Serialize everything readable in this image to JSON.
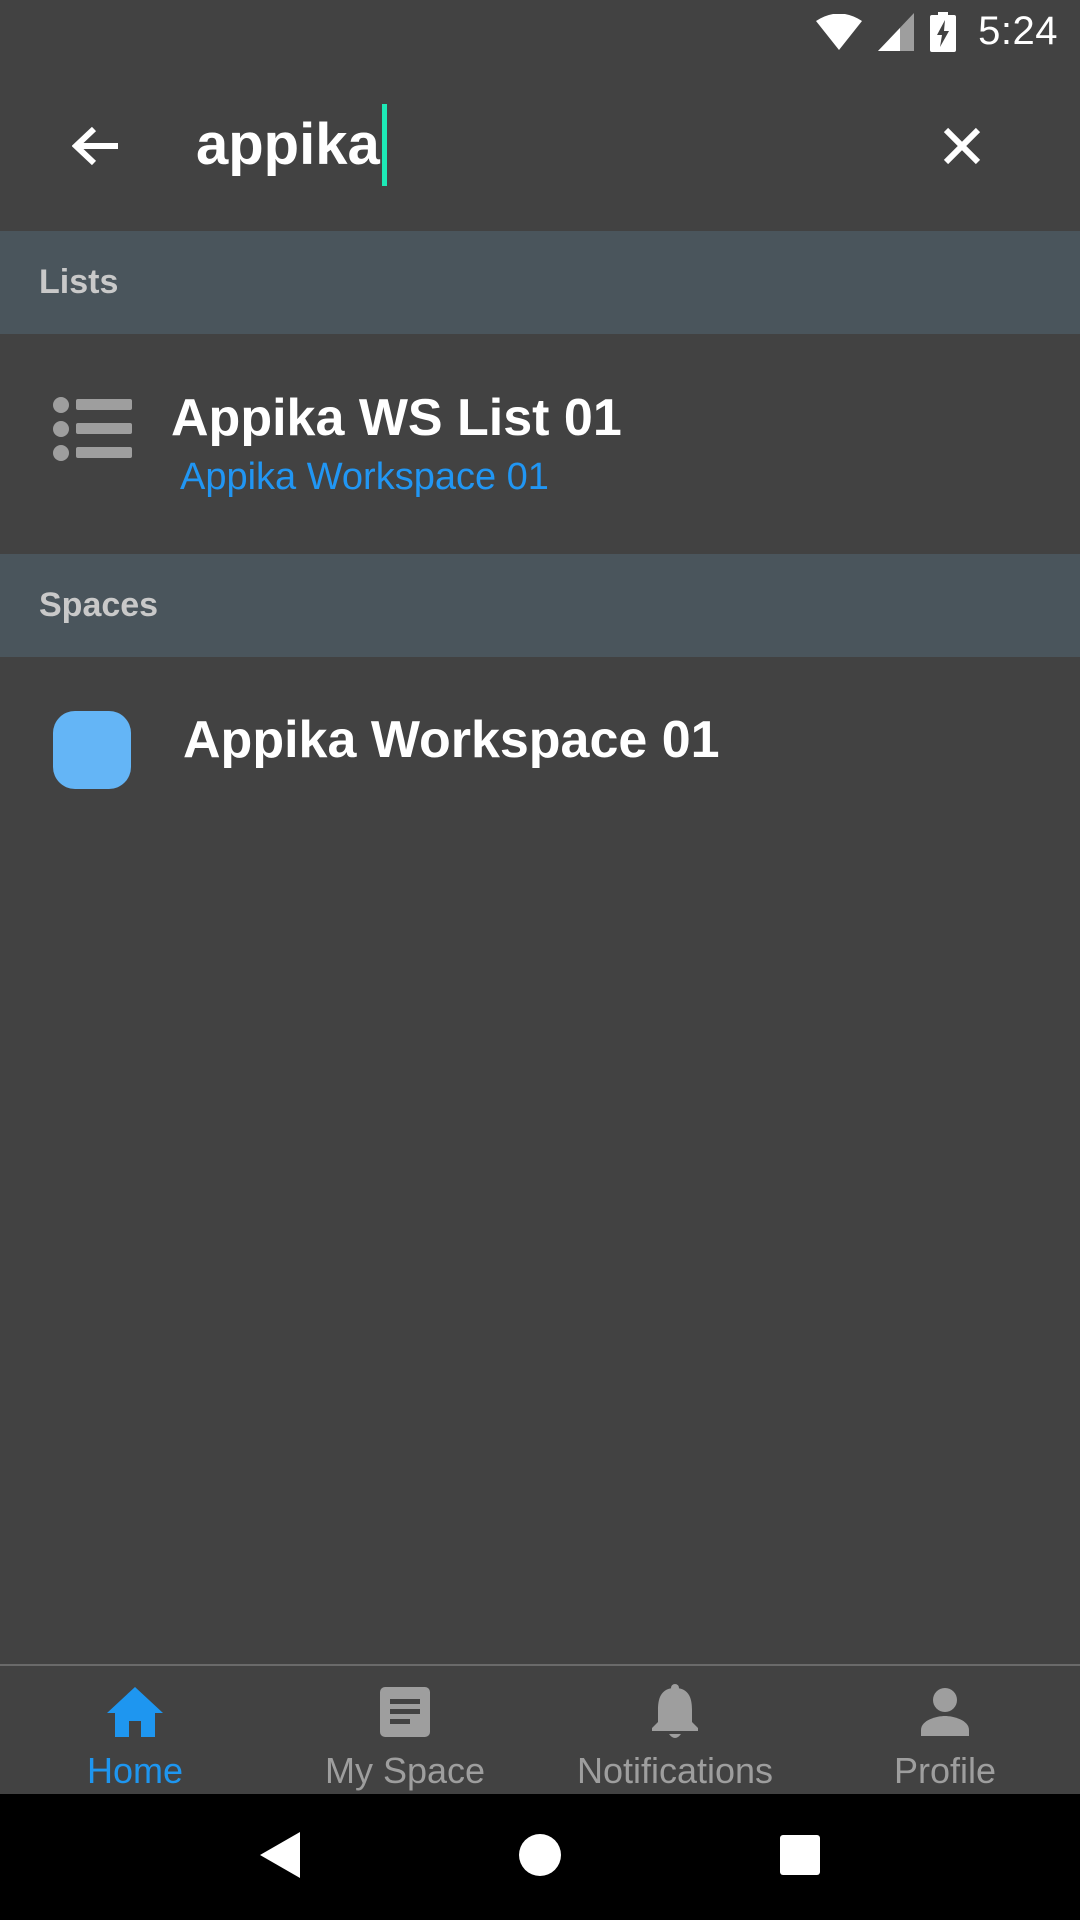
{
  "status_bar": {
    "time": "5:24",
    "icons": [
      "wifi-icon",
      "cellular-signal-icon",
      "battery-charging-icon"
    ]
  },
  "search": {
    "query": "appika",
    "back_icon": "arrow-back-icon",
    "clear_icon": "close-icon"
  },
  "sections": {
    "lists": {
      "header": "Lists",
      "items": [
        {
          "title": "Appika WS List 01",
          "subtitle": "Appika Workspace 01",
          "icon": "list-icon"
        }
      ]
    },
    "spaces": {
      "header": "Spaces",
      "items": [
        {
          "title": "Appika Workspace 01",
          "color": "#64b5f6"
        }
      ]
    }
  },
  "bottom_nav": {
    "items": [
      {
        "label": "Home",
        "icon": "home-icon",
        "active": true
      },
      {
        "label": "My Space",
        "icon": "note-icon",
        "active": false
      },
      {
        "label": "Notifications",
        "icon": "bell-icon",
        "active": false
      },
      {
        "label": "Profile",
        "icon": "person-icon",
        "active": false
      }
    ]
  },
  "system_nav": {
    "icons": [
      "back-triangle-icon",
      "home-circle-icon",
      "recents-square-icon"
    ]
  },
  "colors": {
    "background": "#424242",
    "section_header": "#4a555c",
    "accent": "#2196f3",
    "active_nav": "#1e96f0",
    "caret": "#1de9b6",
    "inactive_nav": "#9e9e9e"
  }
}
